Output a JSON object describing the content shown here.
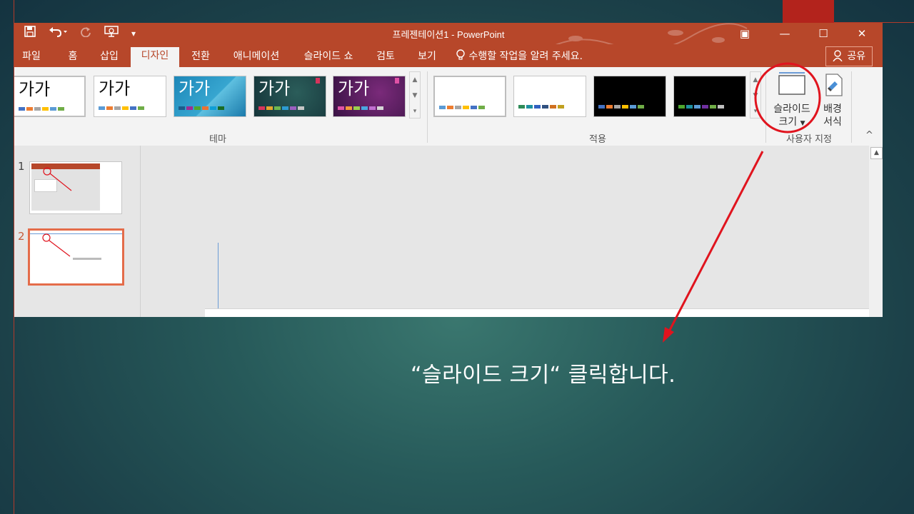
{
  "window": {
    "title": "프레젠테이션1 - PowerPoint",
    "minimize": "—",
    "maximize": "☐",
    "close": "✕",
    "ribbon_display": "▣"
  },
  "quick_access": {
    "save_icon": "save-icon",
    "undo_icon": "undo-icon",
    "redo_icon": "redo-icon",
    "present_icon": "start-from-beginning-icon",
    "customize_icon": "customize-qat-icon"
  },
  "tabs": [
    {
      "label": "파일"
    },
    {
      "label": "홈"
    },
    {
      "label": "삽입"
    },
    {
      "label": "디자인",
      "active": true
    },
    {
      "label": "전환"
    },
    {
      "label": "애니메이션"
    },
    {
      "label": "슬라이드 쇼"
    },
    {
      "label": "검토"
    },
    {
      "label": "보기"
    }
  ],
  "tell_me": "수행할 작업을 알려 주세요.",
  "share": "공유",
  "themes": {
    "group_label": "테마",
    "items": [
      {
        "sample": "가가",
        "style": "office"
      },
      {
        "sample": "가가",
        "style": "office-theme"
      },
      {
        "sample": "가가",
        "style": "facet-blue"
      },
      {
        "sample": "가가",
        "style": "ion-dark"
      },
      {
        "sample": "가가",
        "style": "ion-purple"
      }
    ]
  },
  "variants": {
    "group_label": "적용",
    "items": [
      {
        "style": "white-1"
      },
      {
        "style": "white-2"
      },
      {
        "style": "black-1"
      },
      {
        "style": "black-2"
      }
    ]
  },
  "customize": {
    "group_label": "사용자 지정",
    "slide_size_label_line1": "슬라이드",
    "slide_size_label_line2": "크기",
    "format_bg_line1": "배경",
    "format_bg_line2": "서식",
    "collapse": "^"
  },
  "slides": [
    {
      "number": "1"
    },
    {
      "number": "2",
      "selected": true
    }
  ],
  "caption": "“슬라이드 크기“ 클릭합니다.",
  "colors": {
    "accent": "#b7472a",
    "annotation": "#e0141e"
  }
}
